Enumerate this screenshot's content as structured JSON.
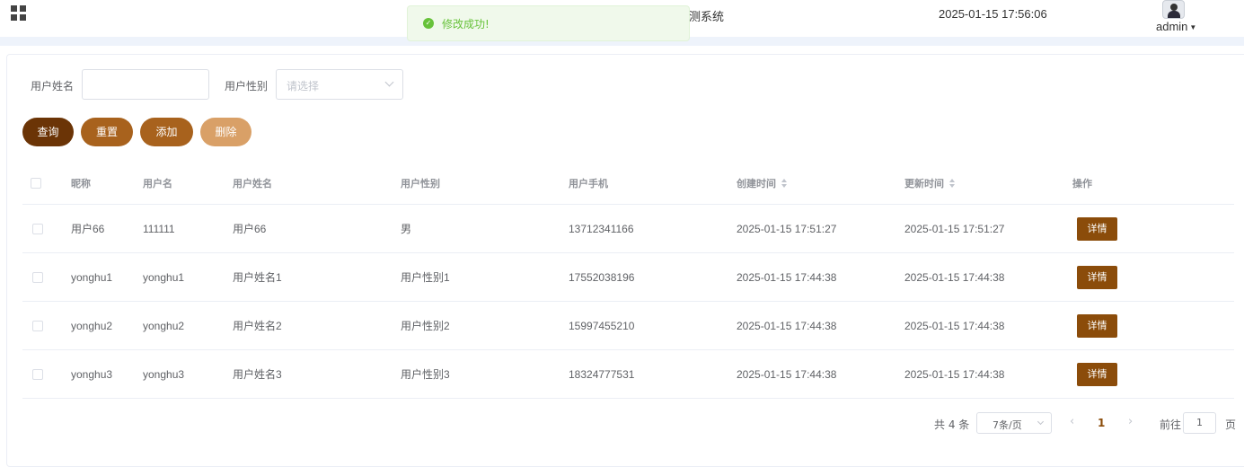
{
  "header": {
    "title_fragment": "测系统",
    "datetime": "2025-01-15 17:56:06",
    "user": "admin"
  },
  "toast": {
    "message": "修改成功!",
    "type": "success",
    "color": "#67c23a"
  },
  "filters": {
    "name_label": "用户姓名",
    "name_value": "",
    "gender_label": "用户性别",
    "gender_placeholder": "请选择"
  },
  "buttons": {
    "search": "查询",
    "reset": "重置",
    "add": "添加",
    "delete": "删除"
  },
  "colors": {
    "search": "#6b3406",
    "reset": "#a8621d",
    "add": "#a8621d",
    "delete": "#d9a067",
    "detail": "#8b4c0a"
  },
  "table": {
    "columns": [
      "昵称",
      "用户名",
      "用户姓名",
      "用户性别",
      "用户手机",
      "创建时间",
      "更新时间",
      "操作"
    ],
    "rows": [
      {
        "nickname": "用户66",
        "username": "111111",
        "realname": "用户66",
        "gender": "男",
        "phone": "13712341166",
        "created": "2025-01-15 17:51:27",
        "updated": "2025-01-15 17:51:27",
        "action": "详情"
      },
      {
        "nickname": "yonghu1",
        "username": "yonghu1",
        "realname": "用户姓名1",
        "gender": "用户性别1",
        "phone": "17552038196",
        "created": "2025-01-15 17:44:38",
        "updated": "2025-01-15 17:44:38",
        "action": "详情"
      },
      {
        "nickname": "yonghu2",
        "username": "yonghu2",
        "realname": "用户姓名2",
        "gender": "用户性别2",
        "phone": "15997455210",
        "created": "2025-01-15 17:44:38",
        "updated": "2025-01-15 17:44:38",
        "action": "详情"
      },
      {
        "nickname": "yonghu3",
        "username": "yonghu3",
        "realname": "用户姓名3",
        "gender": "用户性别3",
        "phone": "18324777531",
        "created": "2025-01-15 17:44:38",
        "updated": "2025-01-15 17:44:38",
        "action": "详情"
      }
    ]
  },
  "pagination": {
    "total": "共 4 条",
    "page_size": "7条/页",
    "prev": "‹",
    "current": "1",
    "next": "›",
    "goto_label": "前往",
    "goto_value": "1",
    "page_suffix": "页"
  }
}
